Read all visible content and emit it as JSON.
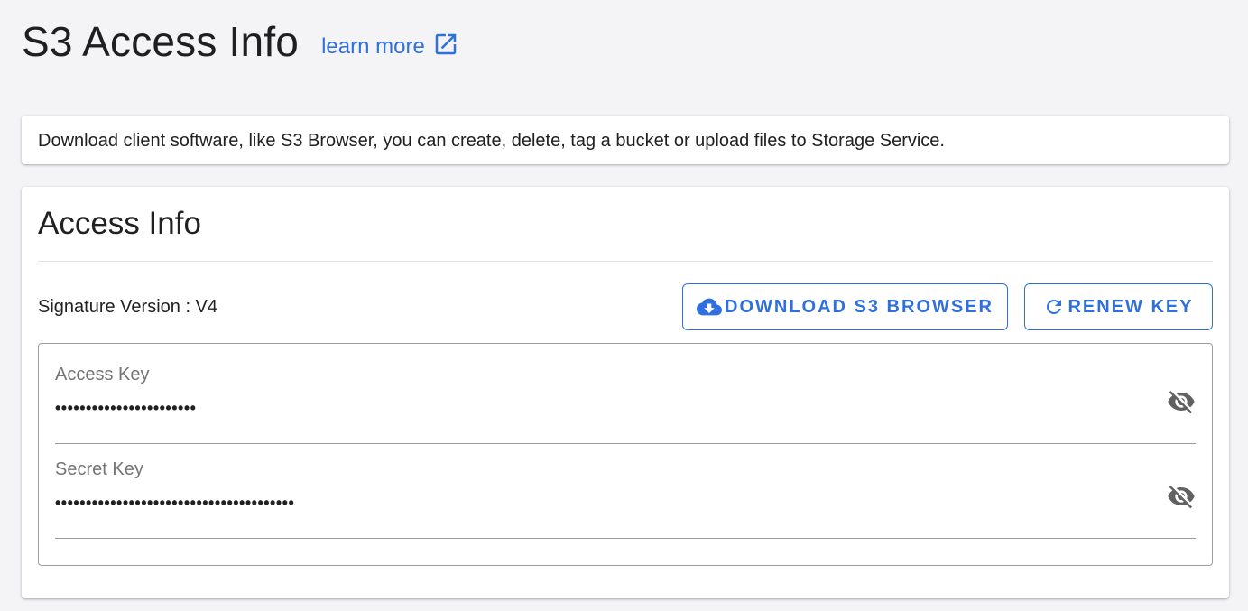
{
  "header": {
    "title": "S3 Access Info",
    "learn_more": "learn more",
    "learn_more_icon": "open-in-new-icon"
  },
  "info_card": {
    "text": "Download client software, like S3 Browser, you can create, delete, tag a bucket or upload files to Storage Service."
  },
  "access_card": {
    "title": "Access Info",
    "signature_version": "Signature Version : V4",
    "buttons": {
      "download_label": "DOWNLOAD S3 BROWSER",
      "download_icon": "cloud-download-icon",
      "renew_label": "RENEW KEY",
      "renew_icon": "refresh-icon"
    },
    "fields": {
      "access_key": {
        "label": "Access Key",
        "value": "•••••••••••••••••••••••",
        "icon": "eye-off-icon"
      },
      "secret_key": {
        "label": "Secret Key",
        "value": "•••••••••••••••••••••••••••••••••••••••",
        "icon": "eye-off-icon"
      }
    }
  },
  "colors": {
    "accent": "#2f6fde",
    "background": "#f4f4f6",
    "card": "#ffffff",
    "label_gray": "#757575"
  }
}
